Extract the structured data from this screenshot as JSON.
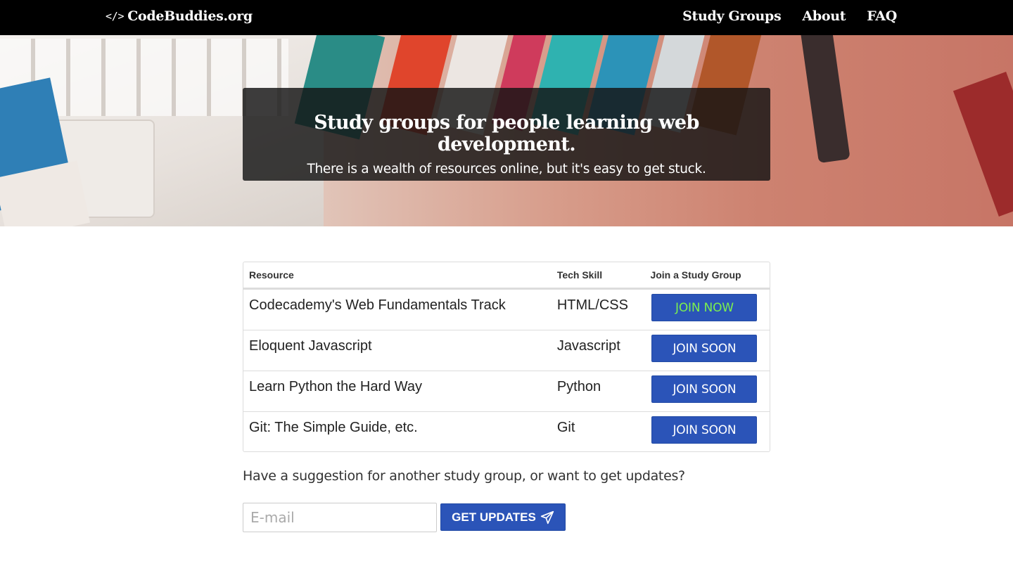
{
  "nav": {
    "brand_icon": "</>",
    "brand": "CodeBuddies.org",
    "links": [
      "Study Groups",
      "About",
      "FAQ"
    ]
  },
  "hero": {
    "title": "Study groups for people learning web development.",
    "subtitle": "There is a wealth of resources online, but it's easy to get stuck."
  },
  "table": {
    "headers": [
      "Resource",
      "Tech Skill",
      "Join a Study Group"
    ],
    "rows": [
      {
        "resource": "Codecademy's Web Fundamentals Track",
        "skill": "HTML/CSS",
        "button": "JOIN NOW",
        "button_text_color": "#7CF04E"
      },
      {
        "resource": "Eloquent Javascript",
        "skill": "Javascript",
        "button": "JOIN SOON",
        "button_text_color": "#ffffff"
      },
      {
        "resource": "Learn Python the Hard Way",
        "skill": "Python",
        "button": "JOIN SOON",
        "button_text_color": "#ffffff"
      },
      {
        "resource": "Git: The Simple Guide, etc.",
        "skill": "Git",
        "button": "JOIN SOON",
        "button_text_color": "#ffffff"
      }
    ]
  },
  "signup": {
    "prompt": "Have a suggestion for another study group, or want to get updates?",
    "email_placeholder": "E-mail",
    "button": "GET UPDATES",
    "button_icon": "paper-plane-icon"
  },
  "colors": {
    "navbar": "#000000",
    "primary_button": "#2b54b8",
    "join_now_text": "#7CF04E"
  }
}
